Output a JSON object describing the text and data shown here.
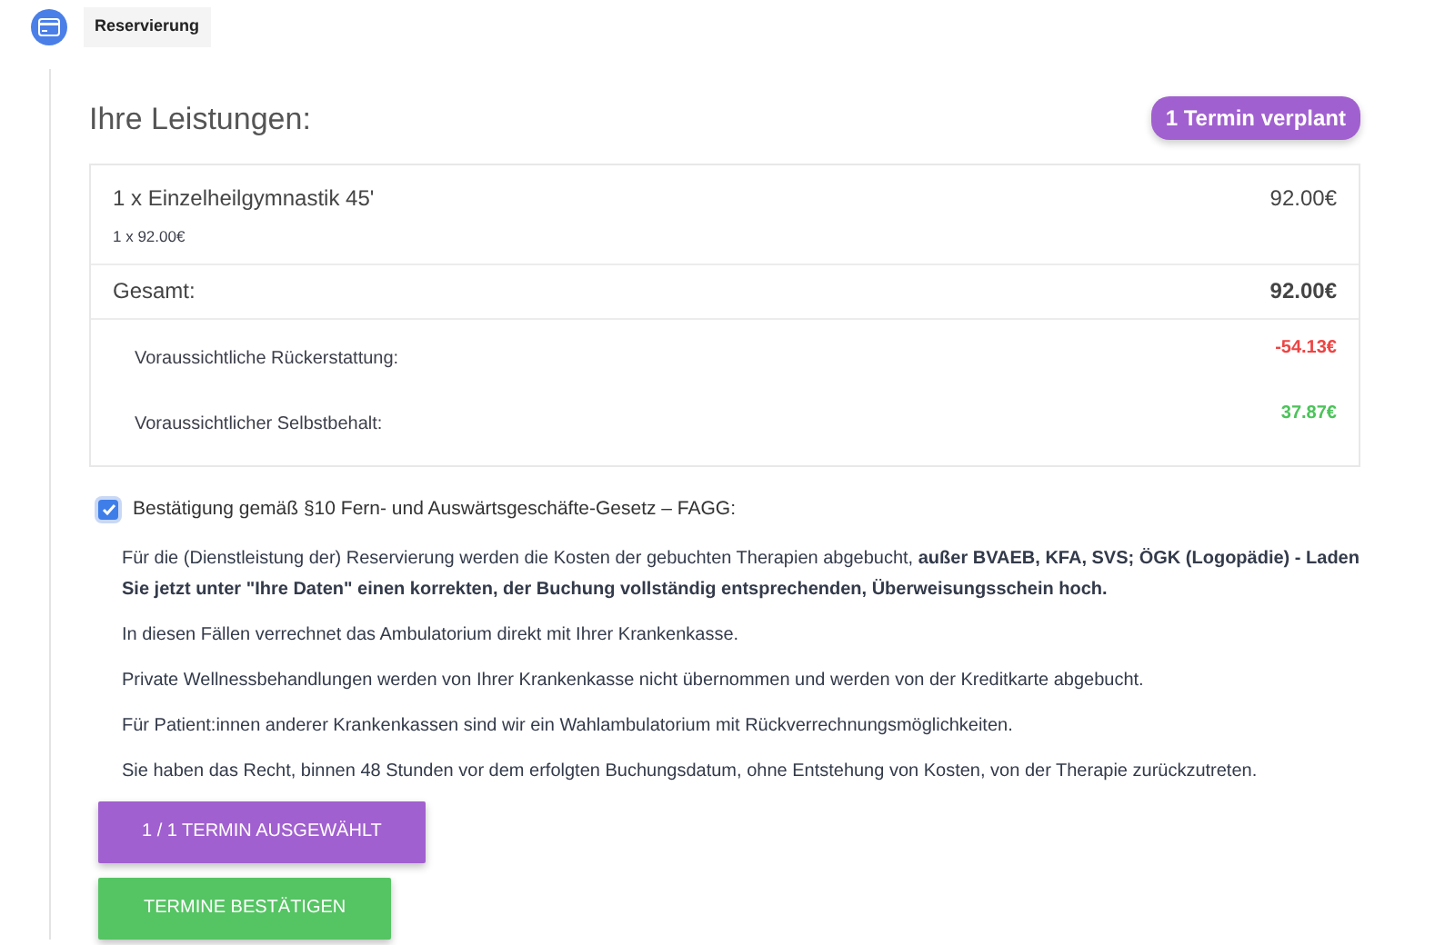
{
  "step": {
    "label": "Reservierung"
  },
  "heading": "Ihre Leistungen:",
  "badge": "1 Termin verplant",
  "items": [
    {
      "title": "1 x Einzelheilgymnastik 45'",
      "subtitle": "1 x 92.00€",
      "price": "92.00€"
    }
  ],
  "total": {
    "label": "Gesamt:",
    "value": "92.00€"
  },
  "estimates": [
    {
      "label": "Voraussichtliche Rückerstattung:",
      "value": "-54.13€",
      "color": "#ee4444"
    },
    {
      "label": "Voraussichtlicher Selbstbehalt:",
      "value": "37.87€",
      "color": "#4cc35a"
    }
  ],
  "confirmation": {
    "label": "Bestätigung gemäß §10 Fern- und Auswärtsgeschäfte-Gesetz – FAGG:",
    "checked": true
  },
  "paragraphs": [
    "Für die (Dienstleistung der) Reservierung werden die Kosten der gebuchten Therapien abgebucht, **außer BVAEB, KFA, SVS; ÖGK (Logopädie) - Laden Sie jetzt unter \"Ihre Daten\" einen korrekten, der Buchung vollständig entsprechenden, Überweisungsschein hoch.**",
    "In diesen Fällen verrechnet das Ambulatorium direkt mit Ihrer Krankenkasse.",
    "Private Wellnessbehandlungen werden von Ihrer Krankenkasse nicht übernommen und werden von der Kreditkarte abgebucht.",
    "Für Patient:innen anderer Krankenkassen sind wir ein Wahlambulatorium mit Rückverrechnungsmöglichkeiten.",
    "Sie haben das Recht, binnen 48 Stunden vor dem erfolgten Buchungsdatum, ohne Entstehung von Kosten, von der Therapie zurückzutreten."
  ],
  "buttons": [
    {
      "label": "1 / 1 TERMIN AUSGEWÄHLT",
      "color": "#a160cf"
    },
    {
      "label": "TERMINE BESTÄTIGEN",
      "color": "#55c463"
    }
  ]
}
